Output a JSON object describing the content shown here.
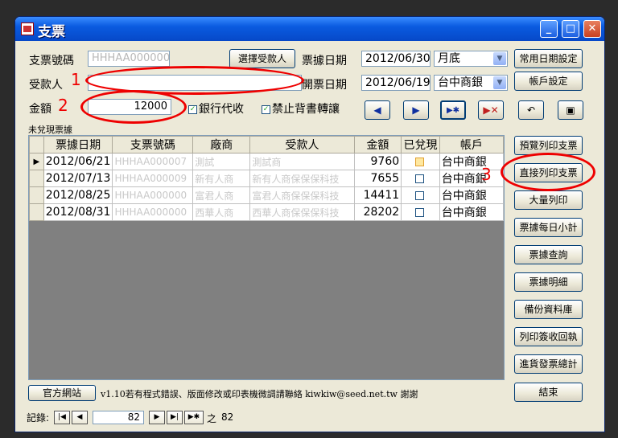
{
  "window": {
    "title": "支票",
    "min": "_",
    "max": "□",
    "close": "✕"
  },
  "form": {
    "check_no_label": "支票號碼",
    "check_no_value": "HHHAA000000",
    "payee_label": "受款人",
    "payee_value": "",
    "amount_label": "金額",
    "amount_value": "12000",
    "select_payee_button": "選擇受款人",
    "bill_date_label": "票據日期",
    "bill_date_value": "2012/06/30",
    "bill_date_mode": "月底",
    "issue_date_label": "開票日期",
    "issue_date_value": "2012/06/19",
    "bank_value": "台中商銀",
    "bank_collect_label": "銀行代收",
    "no_endorse_label": "禁止背書轉讓",
    "common_date_button": "常用日期設定",
    "account_button": "帳戶設定",
    "unpaid_label": "未兌現票據"
  },
  "annotations": {
    "n1": "1",
    "n2": "2",
    "n3": "3"
  },
  "table": {
    "columns": [
      "票據日期",
      "支票號碼",
      "廠商",
      "受款人",
      "金額",
      "已兌現",
      "帳戶"
    ],
    "rows": [
      {
        "date": "2012/06/21",
        "no": "HHHAA000007",
        "vendor": "測試",
        "payee": "測試商",
        "amount": "9760",
        "paid": "",
        "account": "台中商銀"
      },
      {
        "date": "2012/07/13",
        "no": "HHHAA000009",
        "vendor": "新有人商",
        "payee": "新有人商保保保科技",
        "amount": "7655",
        "paid": "",
        "account": "台中商銀"
      },
      {
        "date": "2012/08/25",
        "no": "HHHAA000000",
        "vendor": "富君人商",
        "payee": "富君人商保保保科技",
        "amount": "14411",
        "paid": "",
        "account": "台中商銀"
      },
      {
        "date": "2012/08/31",
        "no": "HHHAA000000",
        "vendor": "西華人商",
        "payee": "西華人商保保保科技",
        "amount": "28202",
        "paid": "",
        "account": "台中商銀"
      }
    ]
  },
  "side_buttons": [
    "預覽列印支票",
    "直接列印支票",
    "大量列印",
    "票據每日小計",
    "票據查詢",
    "票據明細",
    "備份資料庫",
    "列印簽收回執",
    "進貨發票總計",
    "結束"
  ],
  "footer": {
    "website_button": "官方網站",
    "notice": "v1.10若有程式錯誤、版面修改或印表機微調請聯絡 kiwkiw@seed.net.tw 謝謝",
    "record_label": "記錄:",
    "record_current": "82",
    "record_of": "之",
    "record_total": "82"
  }
}
